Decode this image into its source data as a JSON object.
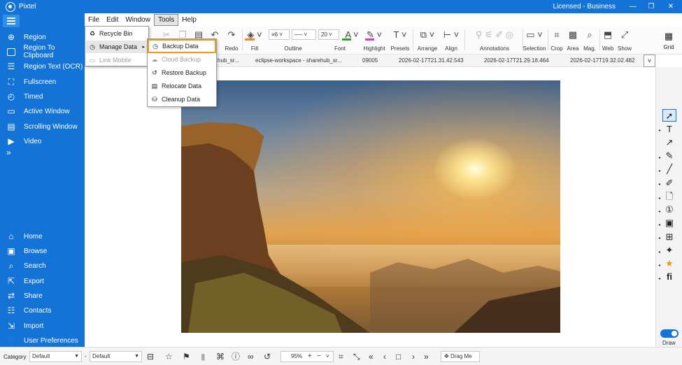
{
  "window": {
    "title": "Pixtel",
    "license": "Licensed - Business",
    "min": "—",
    "restore": "❐",
    "close": "✕"
  },
  "sidebar": {
    "capture_items": [
      {
        "label": "Region",
        "icon": "crosshair-icon"
      },
      {
        "label": "Region To Clipboard",
        "icon": "clipboard-icon"
      },
      {
        "label": "Region Text (OCR)",
        "icon": "ocr-icon"
      },
      {
        "label": "Fullscreen",
        "icon": "fullscreen-icon"
      },
      {
        "label": "Timed",
        "icon": "timer-icon"
      },
      {
        "label": "Active Window",
        "icon": "window-icon"
      },
      {
        "label": "Scrolling Window",
        "icon": "scroll-icon"
      },
      {
        "label": "Video",
        "icon": "video-icon"
      }
    ],
    "more": "»",
    "nav_items": [
      {
        "label": "Home",
        "icon": "home-icon"
      },
      {
        "label": "Browse",
        "icon": "browse-icon"
      },
      {
        "label": "Search",
        "icon": "search-icon"
      },
      {
        "label": "Export",
        "icon": "export-icon"
      },
      {
        "label": "Share",
        "icon": "share-icon"
      },
      {
        "label": "Contacts",
        "icon": "contacts-icon"
      },
      {
        "label": "Import",
        "icon": "import-icon"
      },
      {
        "label": "User Preferences",
        "icon": "user-icon"
      }
    ]
  },
  "menubar": {
    "items": [
      "File",
      "Edit",
      "Window",
      "Tools",
      "Help"
    ],
    "active": "Tools"
  },
  "toolbar": {
    "undo": "o",
    "redo": "Redo",
    "fill": "Fill",
    "outline": "Outline",
    "font": "Font",
    "highlight": "Highlight",
    "presets": "Presets",
    "arrange": "Arrange",
    "align": "Align",
    "annotations": "Annotations",
    "selection": "Selection",
    "crop": "Crop",
    "area": "Area",
    "mag": "Mag.",
    "web": "Web",
    "show": "Show",
    "grid": "Grid",
    "outline_width": "6",
    "font_size": "20"
  },
  "tabs": [
    "hub_sr...",
    "eclipse-workspace - sharehub_sr...",
    "09005",
    "2026-02-17T21.31.42.543",
    "2026-02-17T21.29.18.464",
    "2026-02-17T19.32.02.482"
  ],
  "tools_menu": {
    "items": [
      {
        "label": "Recycle Bin",
        "icon": "recycle-bin-icon",
        "state": "normal"
      },
      {
        "label": "Manage Data",
        "icon": "manage-data-icon",
        "state": "highlighted",
        "submenu": "▸"
      },
      {
        "label": "Link Mobile",
        "icon": "link-mobile-icon",
        "state": "disabled"
      }
    ]
  },
  "manage_data_menu": {
    "items": [
      {
        "label": "Backup Data",
        "icon": "backup-icon",
        "state": "focused"
      },
      {
        "label": "Cloud Backup",
        "icon": "cloud-icon",
        "state": "disabled"
      },
      {
        "label": "Restore Backup",
        "icon": "restore-icon",
        "state": "normal"
      },
      {
        "label": "Relocate Data",
        "icon": "relocate-icon",
        "state": "normal"
      },
      {
        "label": "Cleanup Data",
        "icon": "cleanup-icon",
        "state": "normal"
      }
    ]
  },
  "right_tools": {
    "draw_label": "Draw",
    "tools": [
      "pointer-icon",
      "text-icon",
      "arrow-icon",
      "pen-icon",
      "line-icon",
      "marker-icon",
      "note-icon",
      "step-number-icon",
      "stamp-icon",
      "blur-icon",
      "magic-icon",
      "star-icon",
      "glyph-icon"
    ]
  },
  "bottombar": {
    "category_label": "Category",
    "category_value": "Default",
    "second_value": "Default",
    "zoom": "95%",
    "drag_me": "Drag Me"
  },
  "colors": {
    "accent": "#1473d6",
    "focus_outline": "#f0961e"
  }
}
